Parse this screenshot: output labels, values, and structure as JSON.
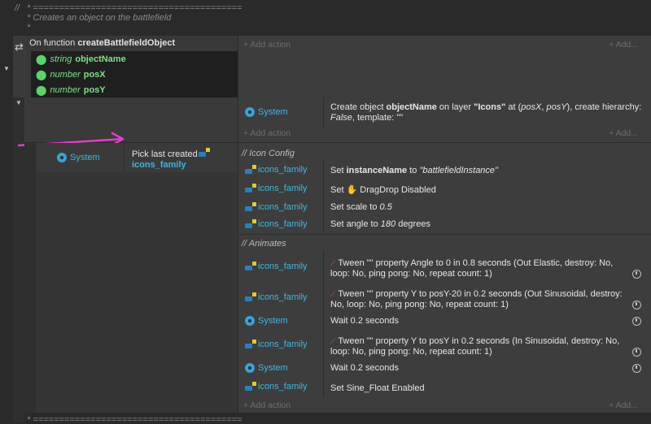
{
  "header_comment": {
    "mark": "//",
    "line1": " * ========================================",
    "line2": " * Creates an object on the battlefield",
    "line3": " *"
  },
  "function_event": {
    "label_prefix": "On function",
    "name": "createBattlefieldObject",
    "params": [
      {
        "type": "string",
        "name": "objectName"
      },
      {
        "type": "number",
        "name": "posX"
      },
      {
        "type": "number",
        "name": "posY"
      }
    ],
    "add_action": "+ Add action",
    "add_more": "+ Add..."
  },
  "create_event": {
    "object": "System",
    "action_prefix": "Create object",
    "object_name": "objectName",
    "action_mid": "on layer",
    "layer": "\"Icons\"",
    "action_at": "at (",
    "posx": "posX",
    "comma": ", ",
    "posy": "posY",
    "action_tail": "), create hierarchy:",
    "hierarchy": "False",
    "template_label": ", template: \"\"",
    "add_action": "+ Add action",
    "add_more": "+ Add..."
  },
  "sub_event": {
    "cond_object": "System",
    "cond_text": "Pick last created",
    "cond_family": "icons_family",
    "group_icon_config": "//  Icon Config",
    "group_animates": "//  Animates",
    "actions": [
      {
        "object": "icons_family",
        "text_parts": [
          "Set ",
          "instanceName",
          " to ",
          "\"battlefieldInstance\""
        ]
      },
      {
        "object": "icons_family",
        "text_parts": [
          "Set ",
          "DragDrop Disabled"
        ]
      },
      {
        "object": "icons_family",
        "text_parts": [
          "Set scale to ",
          "0.5"
        ]
      },
      {
        "object": "icons_family",
        "text_parts": [
          "Set angle to ",
          "180",
          " degrees"
        ]
      }
    ],
    "anim": [
      {
        "object": "icons_family",
        "line1": "Tween \"\" property Angle to 0 in 0.8 seconds (Out Elastic, destroy: No,",
        "line2": "loop: No, ping pong: No, repeat count: 1)"
      },
      {
        "object": "icons_family",
        "line1": "Tween \"\" property Y to posY-20 in 0.2 seconds (Out Sinusoidal, destroy:",
        "line2": "No, loop: No, ping pong: No, repeat count: 1)"
      },
      {
        "object": "System",
        "line1": "Wait 0.2 seconds"
      },
      {
        "object": "icons_family",
        "line1": "Tween \"\" property Y to posY in 0.2 seconds (In Sinusoidal, destroy: No,",
        "line2": "loop: No, ping pong: No, repeat count: 1)"
      },
      {
        "object": "System",
        "line1": "Wait 0.2 seconds"
      },
      {
        "object": "icons_family",
        "line1": "Set Sine_Float Enabled"
      }
    ],
    "add_action": "+ Add action",
    "add_more": "+ Add..."
  },
  "footer_comment": " * ========================================",
  "colors": {
    "accent": "#3fb6e0",
    "param": "#7ee08a",
    "arrow": "#e040c8"
  }
}
